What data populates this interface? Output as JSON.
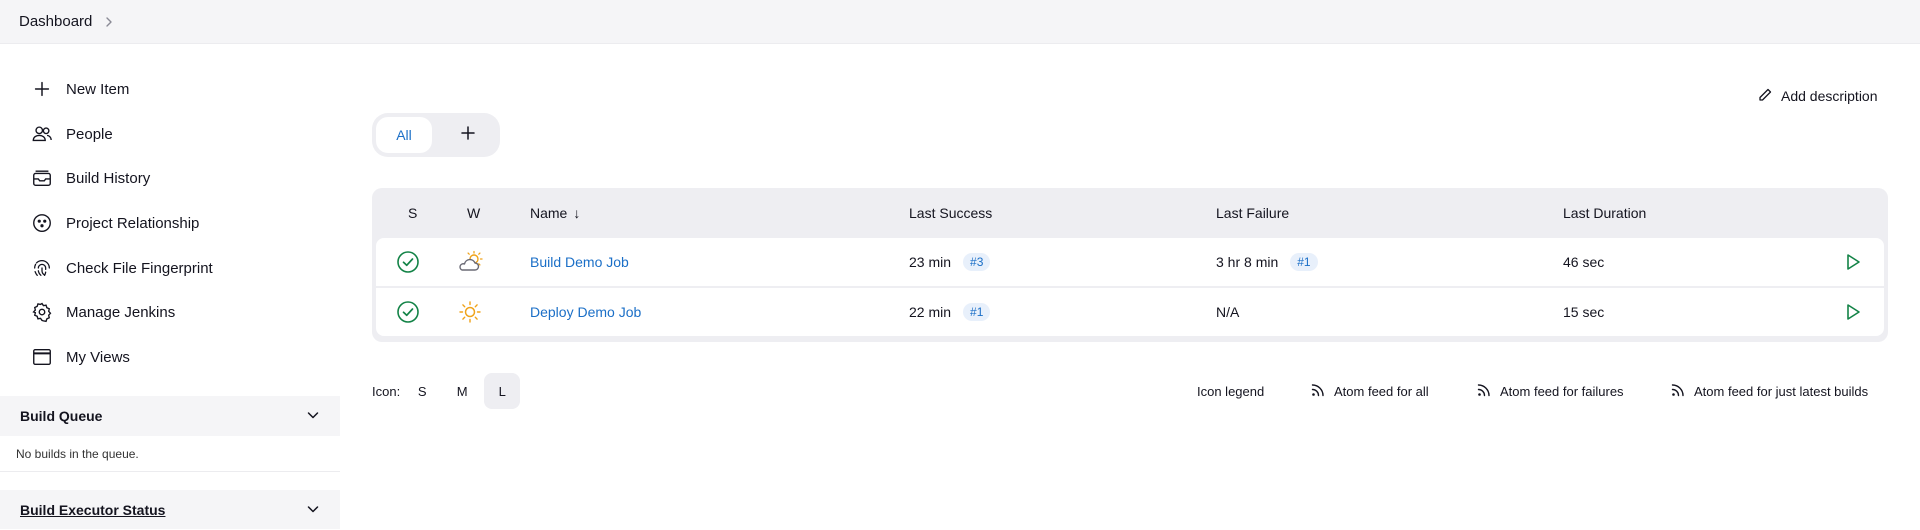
{
  "breadcrumb": {
    "root": "Dashboard"
  },
  "sidebar": {
    "tasks": [
      {
        "label": "New Item",
        "icon": "plus-icon"
      },
      {
        "label": "People",
        "icon": "people-icon"
      },
      {
        "label": "Build History",
        "icon": "build-history-icon"
      },
      {
        "label": "Project Relationship",
        "icon": "relationship-icon"
      },
      {
        "label": "Check File Fingerprint",
        "icon": "fingerprint-icon"
      },
      {
        "label": "Manage Jenkins",
        "icon": "gear-icon"
      },
      {
        "label": "My Views",
        "icon": "window-icon"
      }
    ],
    "build_queue": {
      "title": "Build Queue",
      "empty_text": "No builds in the queue."
    },
    "executor_status": {
      "title": "Build Executor Status"
    }
  },
  "main": {
    "add_description": "Add description",
    "tabs": [
      {
        "label": "All",
        "active": true
      }
    ],
    "table": {
      "headers": {
        "s": "S",
        "w": "W",
        "name": "Name",
        "sort_indicator": "↓",
        "last_success": "Last Success",
        "last_failure": "Last Failure",
        "last_duration": "Last Duration"
      },
      "rows": [
        {
          "status": "success",
          "weather": "partly-cloudy-icon",
          "name": "Build Demo Job",
          "last_success": "23 min",
          "last_success_build": "#3",
          "last_failure": "3 hr 8 min",
          "last_failure_build": "#1",
          "last_duration": "46 sec"
        },
        {
          "status": "success",
          "weather": "sunny-icon",
          "name": "Deploy Demo Job",
          "last_success": "22 min",
          "last_success_build": "#1",
          "last_failure": "N/A",
          "last_failure_build": "",
          "last_duration": "15 sec"
        }
      ]
    },
    "icon_size": {
      "label": "Icon:",
      "options": [
        "S",
        "M",
        "L"
      ],
      "selected": "L"
    },
    "links": {
      "icon_legend": "Icon legend",
      "feed_all": "Atom feed for all",
      "feed_failures": "Atom feed for failures",
      "feed_latest": "Atom feed for just latest builds"
    }
  },
  "colors": {
    "link": "#1b6fc7",
    "success": "#138347",
    "sun": "#f0a31a",
    "bg_subtle": "#f5f5f7"
  }
}
